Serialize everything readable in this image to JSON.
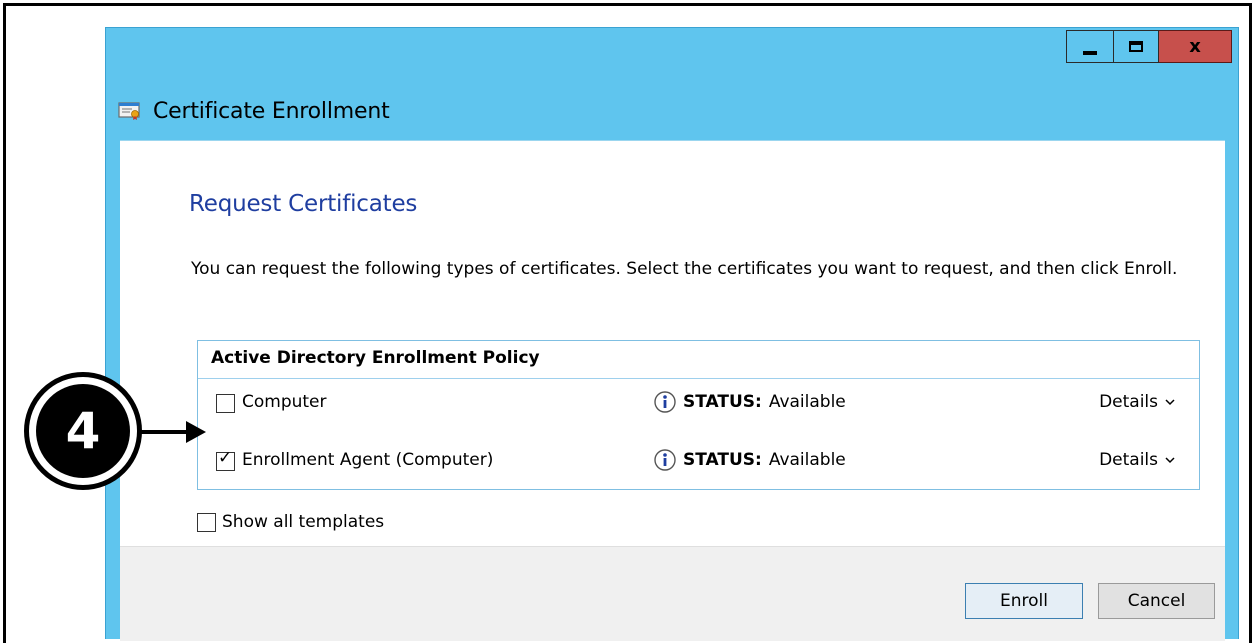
{
  "window": {
    "title": "Certificate Enrollment",
    "controls": [
      "minimize",
      "maximize",
      "close"
    ]
  },
  "page": {
    "heading": "Request Certificates",
    "intro": "You can request the following types of certificates. Select the certificates you want to request, and then click Enroll."
  },
  "policy": {
    "header": "Active Directory Enrollment Policy",
    "certificates": [
      {
        "label": "Computer",
        "checked": false,
        "status_key": "STATUS:",
        "status_value": "Available",
        "details_label": "Details"
      },
      {
        "label": "Enrollment Agent (Computer)",
        "checked": true,
        "status_key": "STATUS:",
        "status_value": "Available",
        "details_label": "Details"
      }
    ]
  },
  "options": {
    "show_all_label": "Show all templates",
    "show_all_checked": false
  },
  "buttons": {
    "enroll": "Enroll",
    "cancel": "Cancel"
  },
  "callout": {
    "number": "4"
  },
  "colors": {
    "window_frame": "#5fc5ee",
    "heading": "#1f3ea0",
    "close_button": "#c7504c"
  },
  "icons": [
    "certificate-icon",
    "info-icon",
    "chevron-down-icon",
    "check-icon",
    "arrow-icon"
  ]
}
